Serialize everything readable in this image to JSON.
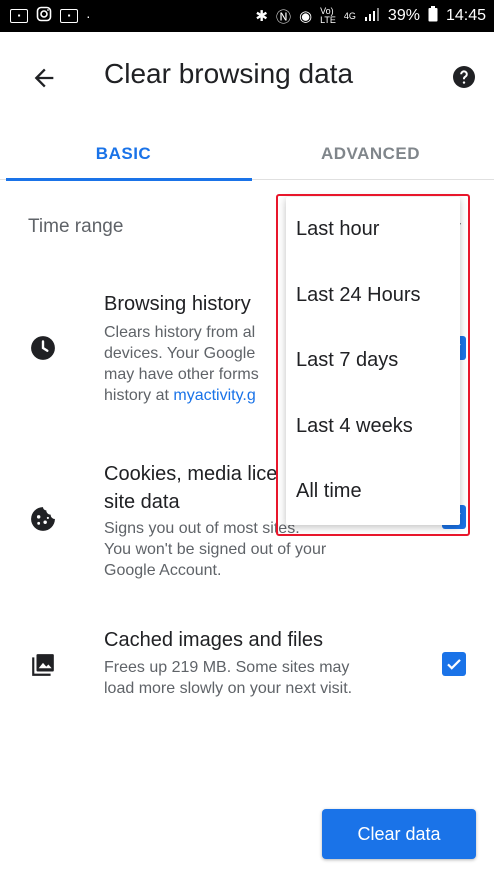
{
  "statusbar": {
    "left_badge_1": "0▪",
    "left_badge_2": "0▪",
    "dot": "·",
    "right_icons": "✱ Ⓝ ◉ ᵛᵒˡ ⁴ᴳ",
    "battery": "39%",
    "time": "14:45"
  },
  "appbar": {
    "title": "Clear browsing data"
  },
  "tabs": [
    {
      "label": "BASIC",
      "selected": true
    },
    {
      "label": "ADVANCED",
      "selected": false
    }
  ],
  "time_range": {
    "label": "Time range"
  },
  "items": [
    {
      "title": "Browsing history",
      "desc_line1": "Clears history from al",
      "desc_line2": "devices. Your Google",
      "desc_line3": "may have other forms",
      "desc_line4_prefix": "history at ",
      "desc_link": "myactivity.g",
      "checked": true
    },
    {
      "title_line1": "Cookies, media lice",
      "title_line2": "site data",
      "desc_line1": "Signs you out of most sites.",
      "desc_line2": "You won't be signed out of your",
      "desc_line3": "Google Account.",
      "checked": true
    },
    {
      "title": "Cached images and files",
      "desc_line1": "Frees up 219 MB. Some sites may",
      "desc_line2": "load more slowly on your next visit.",
      "checked": true
    }
  ],
  "clear_button": {
    "label": "Clear data"
  },
  "dropdown": {
    "options": [
      "Last hour",
      "Last 24 Hours",
      "Last 7 days",
      "Last 4 weeks",
      "All time"
    ]
  },
  "colors": {
    "accent": "#1a73e8",
    "highlight": "#e8162b"
  }
}
